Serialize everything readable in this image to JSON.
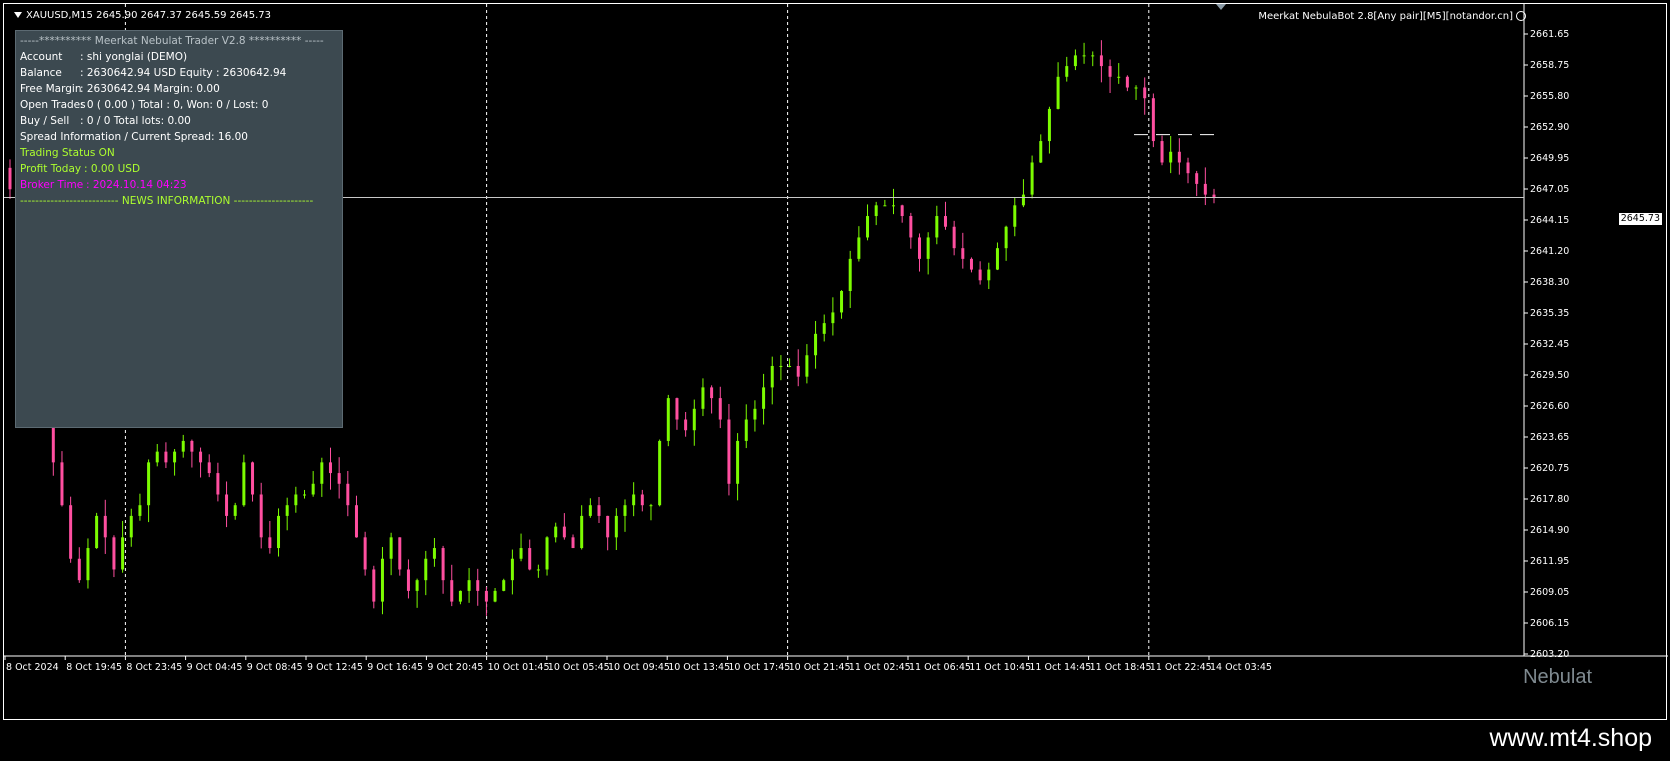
{
  "window": {
    "symbol_header": "XAUUSD,M15  2645.90 2647.37 2645.59 2645.73",
    "ea_name": "Meerkat NebulaBot 2.8[Any pair][M5][notandor.cn]"
  },
  "panel": {
    "title": "-----********** Meerkat Nebulat Trader V2.8   ********** -----",
    "account_label": "Account",
    "account_value": ": shi yonglai (DEMO)",
    "balance_label": "Balance",
    "balance_value": ": 2630642.94 USD  Equity : 2630642.94",
    "free_margin_label": "Free Margin",
    "free_margin_value": ": 2630642.94     Margin: 0.00",
    "open_trades_label": "Open Trades",
    "open_trades_value": ": 0 ( 0.00 ) Total : 0, Won: 0 / Lost: 0",
    "buy_sell_label": "Buy / Sell",
    "buy_sell_value": ": 0 / 0 Total lots: 0.00",
    "spread_text": "Spread Information / Current Spread: 16.00",
    "trading_status": "Trading Status ON",
    "profit_label": "Profit Today",
    "profit_value": ": 0.00 USD",
    "broker_time_label": "Broker Time",
    "broker_time_value": ": 2024.10.14 04:23",
    "news_header": "-------------------------- NEWS INFORMATION ---------------------"
  },
  "current_price": "2645.73",
  "watermark": "Nebulat",
  "brand": "www.mt4.shop",
  "colors": {
    "background": "#000000",
    "bull": "#7cfc00",
    "bear": "#ff4fa0",
    "panel_bg": "#3c4950",
    "grid": "#ffffff"
  },
  "chart_data": {
    "type": "candlestick",
    "y_ticks": [
      "2661.65",
      "2658.75",
      "2655.80",
      "2652.90",
      "2649.95",
      "2647.05",
      "2644.15",
      "2641.20",
      "2638.30",
      "2635.35",
      "2632.45",
      "2629.50",
      "2626.60",
      "2623.65",
      "2620.75",
      "2617.80",
      "2614.90",
      "2611.95",
      "2609.05",
      "2606.15",
      "2603.20"
    ],
    "ylim": [
      2603.2,
      2661.65
    ],
    "x_ticks": [
      "8 Oct 2024",
      "8 Oct 19:45",
      "8 Oct 23:45",
      "9 Oct 04:45",
      "9 Oct 08:45",
      "9 Oct 12:45",
      "9 Oct 16:45",
      "9 Oct 20:45",
      "10 Oct 01:45",
      "10 Oct 05:45",
      "10 Oct 09:45",
      "10 Oct 13:45",
      "10 Oct 17:45",
      "10 Oct 21:45",
      "11 Oct 02:45",
      "11 Oct 06:45",
      "11 Oct 10:45",
      "11 Oct 14:45",
      "11 Oct 18:45",
      "11 Oct 22:45",
      "14 Oct 03:45"
    ],
    "day_separators": [
      "8 Oct 23:45",
      "10 Oct 01:45",
      "10 Oct 21:45",
      "11 Oct 22:45"
    ],
    "close_path": [
      2646.5,
      2640,
      2637,
      2632,
      2627,
      2621,
      2617,
      2612,
      2610,
      2613,
      2616,
      2614,
      2611,
      2614,
      2616,
      2617,
      2621,
      2622,
      2621,
      2622,
      2623,
      2622,
      2621,
      2620,
      2618,
      2616,
      2617,
      2621,
      2618,
      2614,
      2613,
      2616,
      2617,
      2618,
      2618,
      2619,
      2621,
      2620,
      2619,
      2617,
      2614,
      2611,
      2608,
      2612,
      2614,
      2611,
      2609,
      2610,
      2612,
      2613,
      2610,
      2608,
      2609,
      2610,
      2609,
      2608,
      2609,
      2610,
      2612,
      2613,
      2611,
      2611,
      2614,
      2615,
      2614,
      2613,
      2616,
      2617,
      2616,
      2614,
      2616,
      2617,
      2618,
      2617,
      2617,
      2623,
      2627,
      2625,
      2624,
      2626,
      2628,
      2627,
      2625,
      2619,
      2623,
      2625,
      2626,
      2628,
      2630,
      2630,
      2630,
      2629,
      2631,
      2633,
      2634,
      2635,
      2637,
      2640,
      2642,
      2644,
      2645,
      2645,
      2645,
      2644,
      2642,
      2640,
      2642,
      2644,
      2643,
      2641,
      2640,
      2639,
      2638,
      2639,
      2641,
      2643,
      2645,
      2646,
      2649,
      2651,
      2654,
      2657,
      2658,
      2659,
      2659,
      2659,
      2658,
      2657,
      2657,
      2656,
      2656,
      2655,
      2651,
      2649,
      2650,
      2649,
      2648,
      2647,
      2646,
      2645.73
    ]
  }
}
